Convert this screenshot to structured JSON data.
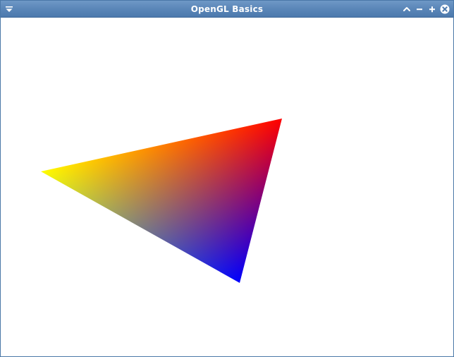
{
  "window": {
    "title": "OpenGL Basics"
  },
  "titlebar": {
    "icons": {
      "menu": "window-menu-icon",
      "shade": "shade-icon",
      "minimize": "minimize-icon",
      "maximize": "maximize-icon",
      "close": "close-icon"
    },
    "colors": {
      "bar": "#5a86b8",
      "text": "#ffffff"
    }
  },
  "scene": {
    "background": "#ffffff",
    "triangle": {
      "vertex_colors": [
        "#ffff00",
        "#ff0000",
        "#0000ff"
      ]
    }
  }
}
